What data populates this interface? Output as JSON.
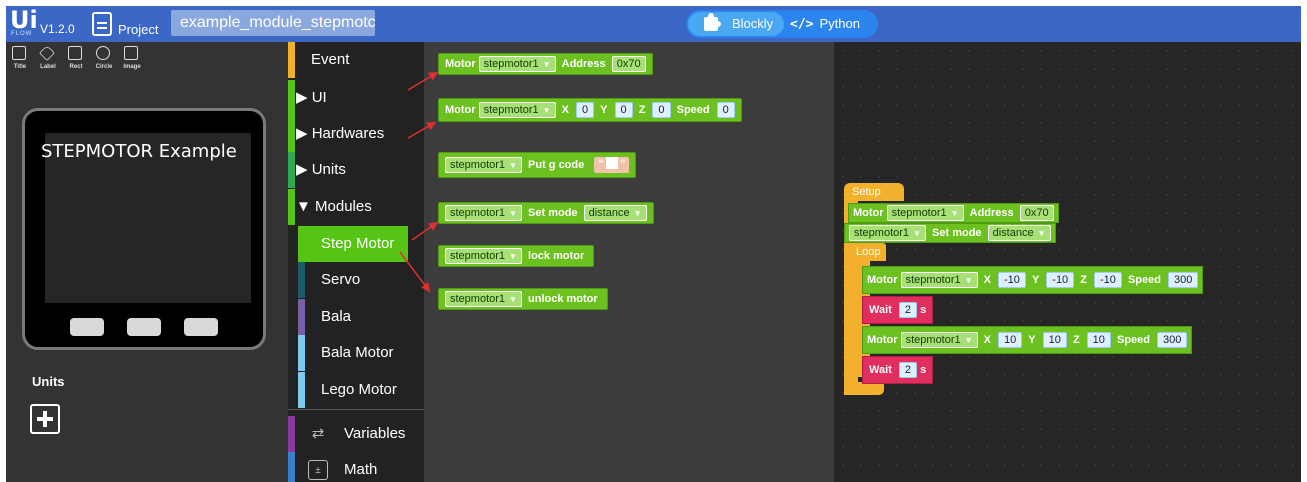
{
  "topbar": {
    "logo": "Ui",
    "logo_sub": "FLOW",
    "version": "V1.2.0",
    "project_label": "Project",
    "project_name": "example_module_stepmotc",
    "mode_blockly": "Blockly",
    "mode_python": "Python"
  },
  "tools": [
    "Title",
    "Label",
    "Rect",
    "Circle",
    "Image"
  ],
  "device": {
    "screen_title": "STEPMOTOR Example"
  },
  "units": {
    "label": "Units"
  },
  "categories": [
    {
      "label": "Event",
      "color": "#f2b02d"
    },
    {
      "label": "UI",
      "color": "#55c414"
    },
    {
      "label": "Hardwares",
      "color": "#55c414"
    },
    {
      "label": "Units",
      "color": "#2ea852"
    },
    {
      "label": "Modules",
      "color": "#55c414"
    },
    {
      "label": "Step Motor",
      "color": "#55c414"
    },
    {
      "label": "Servo",
      "color": "#1c5a6b"
    },
    {
      "label": "Bala",
      "color": "#7a5ea8"
    },
    {
      "label": "Bala Motor",
      "color": "#7fc8ee"
    },
    {
      "label": "Lego Motor",
      "color": "#7fc8ee"
    },
    {
      "label": "Variables",
      "color": "#8d3a9e"
    },
    {
      "label": "Math",
      "color": "#3a7fc9"
    }
  ],
  "flyout": {
    "b1": {
      "motor": "Motor",
      "var": "stepmotor1",
      "address": "Address",
      "addr_val": "0x70"
    },
    "b2": {
      "motor": "Motor",
      "var": "stepmotor1",
      "x": "X",
      "x_val": "0",
      "y": "Y",
      "y_val": "0",
      "z": "Z",
      "z_val": "0",
      "speed": "Speed",
      "speed_val": "0"
    },
    "b3": {
      "var": "stepmotor1",
      "label": "Put g code"
    },
    "b4": {
      "var": "stepmotor1",
      "label": "Set mode",
      "mode": "distance"
    },
    "b5": {
      "var": "stepmotor1",
      "label": "lock motor"
    },
    "b6": {
      "var": "stepmotor1",
      "label": "unlock motor"
    }
  },
  "workspace": {
    "setup": "Setup",
    "loop": "Loop",
    "w1": {
      "motor": "Motor",
      "var": "stepmotor1",
      "address": "Address",
      "addr_val": "0x70"
    },
    "w2": {
      "var": "stepmotor1",
      "label": "Set mode",
      "mode": "distance"
    },
    "m1": {
      "motor": "Motor",
      "var": "stepmotor1",
      "x": "X",
      "x_val": "-10",
      "y": "Y",
      "y_val": "-10",
      "z": "Z",
      "z_val": "-10",
      "speed": "Speed",
      "speed_val": "300"
    },
    "wait1": {
      "wait": "Wait",
      "val": "2",
      "unit": "s"
    },
    "m2": {
      "motor": "Motor",
      "var": "stepmotor1",
      "x": "X",
      "x_val": "10",
      "y": "Y",
      "y_val": "10",
      "z": "Z",
      "z_val": "10",
      "speed": "Speed",
      "speed_val": "300"
    },
    "wait2": {
      "wait": "Wait",
      "val": "2",
      "unit": "s"
    }
  }
}
